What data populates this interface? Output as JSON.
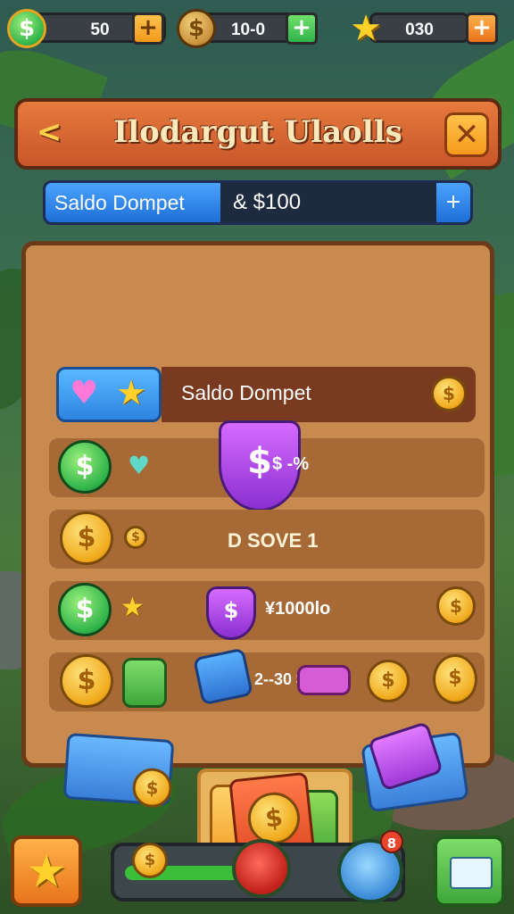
{
  "topbar": {
    "cash": {
      "icon": "dollar-icon",
      "value": "50",
      "plus": "+"
    },
    "coins": {
      "icon": "coin-icon",
      "value": "10-0",
      "plus": "+"
    },
    "stars": {
      "icon": "star-icon",
      "value": "030",
      "plus": "+"
    }
  },
  "window": {
    "title": "Ilodargut Ulaolls",
    "back_icon": "<",
    "close_icon": "✕"
  },
  "wallet": {
    "label": "Saldo Dompet",
    "value": "& $100",
    "action_icon": "+"
  },
  "rows": {
    "header_label": "Saldo Dompet",
    "row1_text": "$ -%",
    "row2_text": "D SOVE 1",
    "row3_text": "¥1000lo",
    "row4_text": "2--30 $"
  },
  "coin_symbol": "$",
  "colors": {
    "panel": "#c98a4f",
    "header_orange": "#d9662f",
    "accent_blue": "#2f84e0",
    "accent_green": "#3bbf3b",
    "gold": "#f0a91c"
  },
  "bottom": {
    "badge": "8"
  }
}
